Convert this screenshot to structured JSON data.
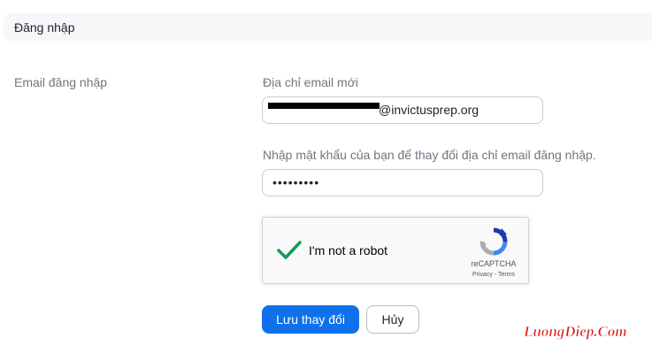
{
  "section": {
    "title": "Đăng nhập"
  },
  "row": {
    "label": "Email đăng nhập"
  },
  "email_field": {
    "label": "Địa chỉ email mới",
    "value_visible": "@invictusprep.org"
  },
  "password_field": {
    "label": "Nhập mật khẩu của bạn để thay đổi địa chỉ email đăng nhập.",
    "masked_value": "•••••••••"
  },
  "recaptcha": {
    "label": "I'm not a robot",
    "brand": "reCAPTCHA",
    "links": "Privacy - Terms",
    "checked": true,
    "check_color": "#0f9d58"
  },
  "actions": {
    "save_label": "Lưu thay đổi",
    "cancel_label": "Hủy"
  },
  "watermark": {
    "text": "LuongDiep.Com"
  },
  "colors": {
    "primary": "#0e71eb",
    "header_bg": "#f6f7f9",
    "label_gray": "#6e7680",
    "watermark_red": "#d61818"
  }
}
